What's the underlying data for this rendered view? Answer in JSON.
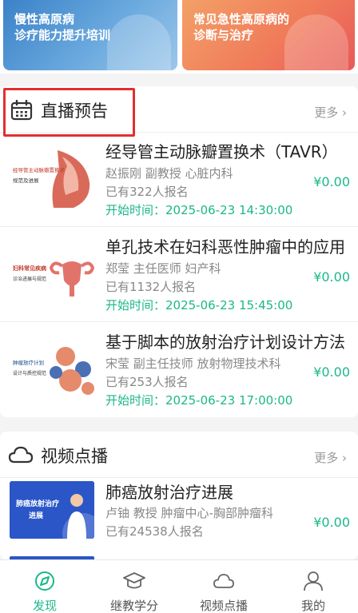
{
  "banners": [
    {
      "line1": "慢性高原病",
      "line2": "诊疗能力提升培训"
    },
    {
      "line1": "常见急性高原病的",
      "line2": "诊断与治疗"
    }
  ],
  "live": {
    "title": "直播预告",
    "more": "更多 ›",
    "items": [
      {
        "name": "经导管主动脉瓣置换术（TAVR）",
        "meta": "赵振刚   副教授   心脏内科",
        "count": "已有322人报名",
        "time": "开始时间：2025-06-23 14:30:00",
        "price": "¥0.00",
        "thumb_line1": "经导管主动脉瓣置换术",
        "thumb_line2": "规范及进展"
      },
      {
        "name": "单孔技术在妇科恶性肿瘤中的应用",
        "meta": "郑莹   主任医师   妇产科",
        "count": "已有1132人报名",
        "time": "开始时间：2025-06-23 15:45:00",
        "price": "¥0.00",
        "thumb_line1": "妇科常见疾病",
        "thumb_line2": "诊治进展与规范"
      },
      {
        "name": "基于脚本的放射治疗计划设计方法",
        "meta": "宋莹   副主任技师   放射物理技术科",
        "count": "已有253人报名",
        "time": "开始时间：2025-06-23 17:00:00",
        "price": "¥0.00",
        "thumb_line1": "肿瘤放疗计划",
        "thumb_line2": "设计与质控规范"
      }
    ]
  },
  "vod": {
    "title": "视频点播",
    "more": "更多 ›",
    "items": [
      {
        "name": "肺癌放射治疗进展",
        "meta": "卢铀   教授   肿瘤中心-胸部肿瘤科",
        "count": "已有24538人报名",
        "price": "¥0.00",
        "thumb_line1": "肺癌放射治疗",
        "thumb_line2": "进展"
      }
    ]
  },
  "nav": [
    {
      "label": "发现",
      "icon": "discover-icon",
      "active": true
    },
    {
      "label": "继教学分",
      "icon": "graduation-cap-icon",
      "active": false
    },
    {
      "label": "视频点播",
      "icon": "cloud-icon",
      "active": false
    },
    {
      "label": "我的",
      "icon": "person-icon",
      "active": false
    }
  ],
  "colors": {
    "accent": "#1bb88a",
    "highlight": "#e03030"
  }
}
